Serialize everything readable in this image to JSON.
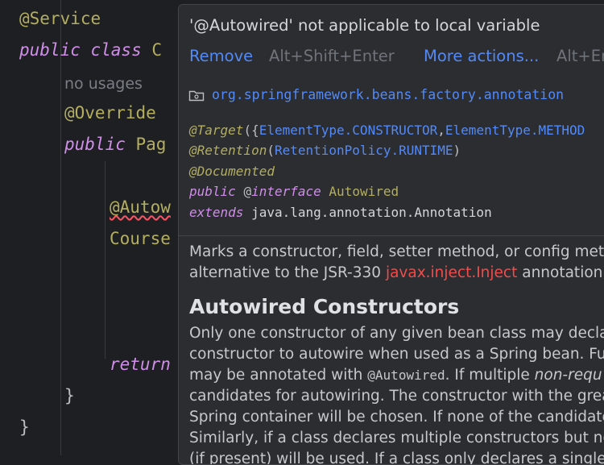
{
  "editor": {
    "line1": "@Service",
    "line2_kw": "public class",
    "line2_rest": "C",
    "usages_hint": "no usages",
    "override": "@Override",
    "line5_kw": "public",
    "line5_rest": "Pag",
    "autowired_partial": "@Autow",
    "course_partial": "Course",
    "return_kw": "return",
    "close_inner": "}",
    "close_outer": "}"
  },
  "popup": {
    "title": "'@Autowired' not applicable to local variable",
    "remove_label": "Remove",
    "remove_shortcut": "Alt+Shift+Enter",
    "more_label": "More actions...",
    "more_shortcut": "Alt+Enter",
    "package": "org.springframework.beans.factory.annotation",
    "sig": {
      "target_annot": "@Target",
      "target_open": "({",
      "target_v1": "ElementType.CONSTRUCTOR",
      "target_comma": ",",
      "target_v2": "ElementType.METHOD",
      "retention_annot": "@Retention",
      "retention_open": "(",
      "retention_v": "RetentionPolicy.RUNTIME",
      "retention_close": ")",
      "documented": "@Documented",
      "public_kw": "public",
      "at": "@",
      "interface_kw": "interface",
      "name": "Autowired",
      "extends_kw": "extends",
      "extends_type": "java.lang.annotation.Annotation"
    },
    "desc": {
      "p1_line1": "Marks a constructor, field, setter method, or config meth",
      "p1_line2_a": "alternative to the JSR-330 ",
      "p1_line2_link": "javax.inject.Inject",
      "p1_line2_b": " annotation,",
      "heading": "Autowired Constructors",
      "l1": "Only one constructor of any given bean class may declar",
      "l2": "constructor to autowire when used as a Spring bean. Fur",
      "l3_a": "may be annotated with ",
      "l3_code": "@Autowired",
      "l3_b": ". If multiple ",
      "l3_it": "non-requ",
      "l4": "candidates for autowiring. The constructor with the grea",
      "l5": "Spring container will be chosen. If none of the candidates",
      "l6": "Similarly, if a class declares multiple constructors but nor",
      "l7": "(if present) will be used. If a class only declares a single c"
    }
  }
}
